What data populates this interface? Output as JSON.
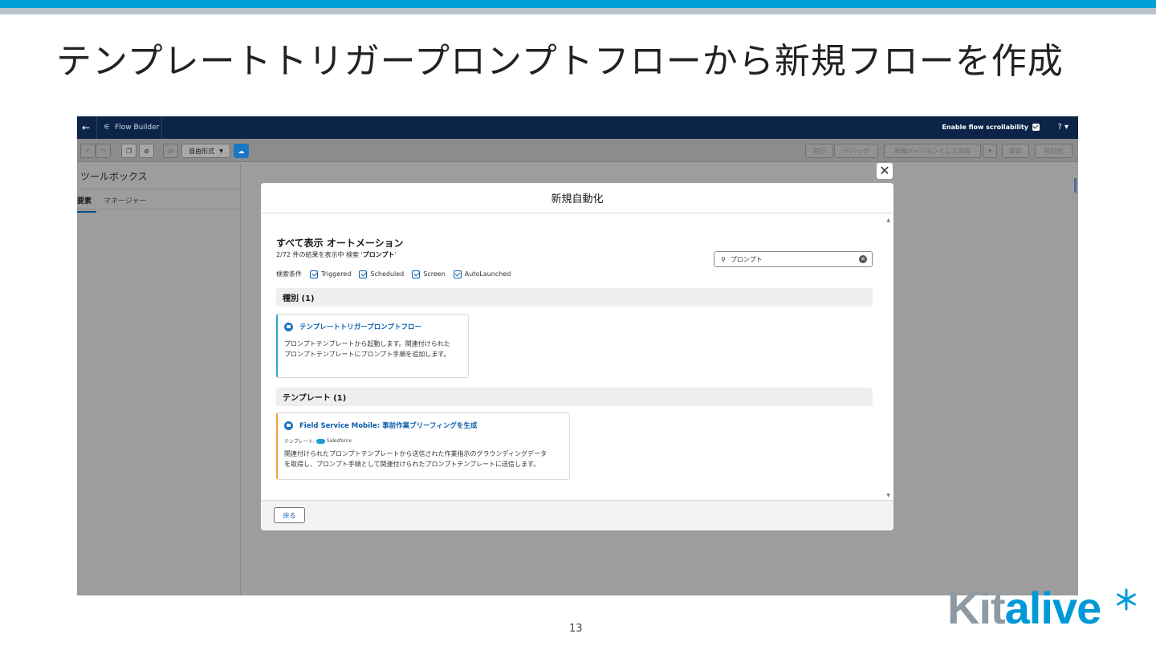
{
  "slide": {
    "title": "テンプレートトリガープロンプトフローから新規フローを作成",
    "page_number": "13",
    "logo": "Kitalive",
    "colors": {
      "top_band": "#00a1d6",
      "logo_blue": "#0099d8",
      "logo_gray": "#8e9aa3"
    }
  },
  "app": {
    "back_icon": "←",
    "app_icon": "⚟",
    "app_name": "Flow Builder",
    "scrollability_label": "Enable flow scrollability",
    "help_label": "? ▾"
  },
  "toolbar": {
    "undo_icon": "↶",
    "redo_icon": "↷",
    "copy_icon": "❐",
    "disable_icon": "⊘",
    "settings_icon": "⚙",
    "layout_mode": "自由形式",
    "layout_caret": "▼",
    "active_icon": "☁",
    "run": "実行",
    "debug": "デバッグ",
    "save_as_new": "新規バージョンとして保存",
    "save_caret": "▼",
    "save": "保存",
    "activate": "有効化"
  },
  "toolbox": {
    "title": "ツールボックス",
    "tab_elements": "要素",
    "tab_manager": "マネージャー"
  },
  "modal": {
    "header": "新規自動化",
    "close_icon": "✕",
    "list_title": "すべて表示 オートメーション",
    "result_prefix": "2/72 件の結果を表示中 検索 '",
    "result_query": "プロンプト",
    "result_suffix": "'",
    "search_icon": "⚲",
    "search_value": "プロンプト",
    "clear_icon": "✕",
    "filter_label": "検索条件",
    "filters": [
      "Triggered",
      "Scheduled",
      "Screen",
      "AutoLaunched"
    ],
    "section_types": "種別 (1)",
    "section_templates": "テンプレート (1)",
    "type_card": {
      "title": "テンプレートトリガープロンプトフロー",
      "desc_line1": "プロンプトテンプレートから起動します。関連付けられた",
      "desc_line2": "プロンプトテンプレートにプロンプト手順を追加します。"
    },
    "template_card": {
      "title": "Field Service Mobile: 事前作業ブリーフィングを生成",
      "sub_label": "テンプレート: ",
      "sub_brand": "Salesforce",
      "desc_line1": "関連付けられたプロンプトテンプレートから送信された作業指示のグラウンディングデータ",
      "desc_line2": "を取得し、プロンプト手順として関連付けられたプロンプトテンプレートに送信します。"
    },
    "back_button": "戻る",
    "scroll_up": "▲",
    "scroll_down": "▼"
  }
}
